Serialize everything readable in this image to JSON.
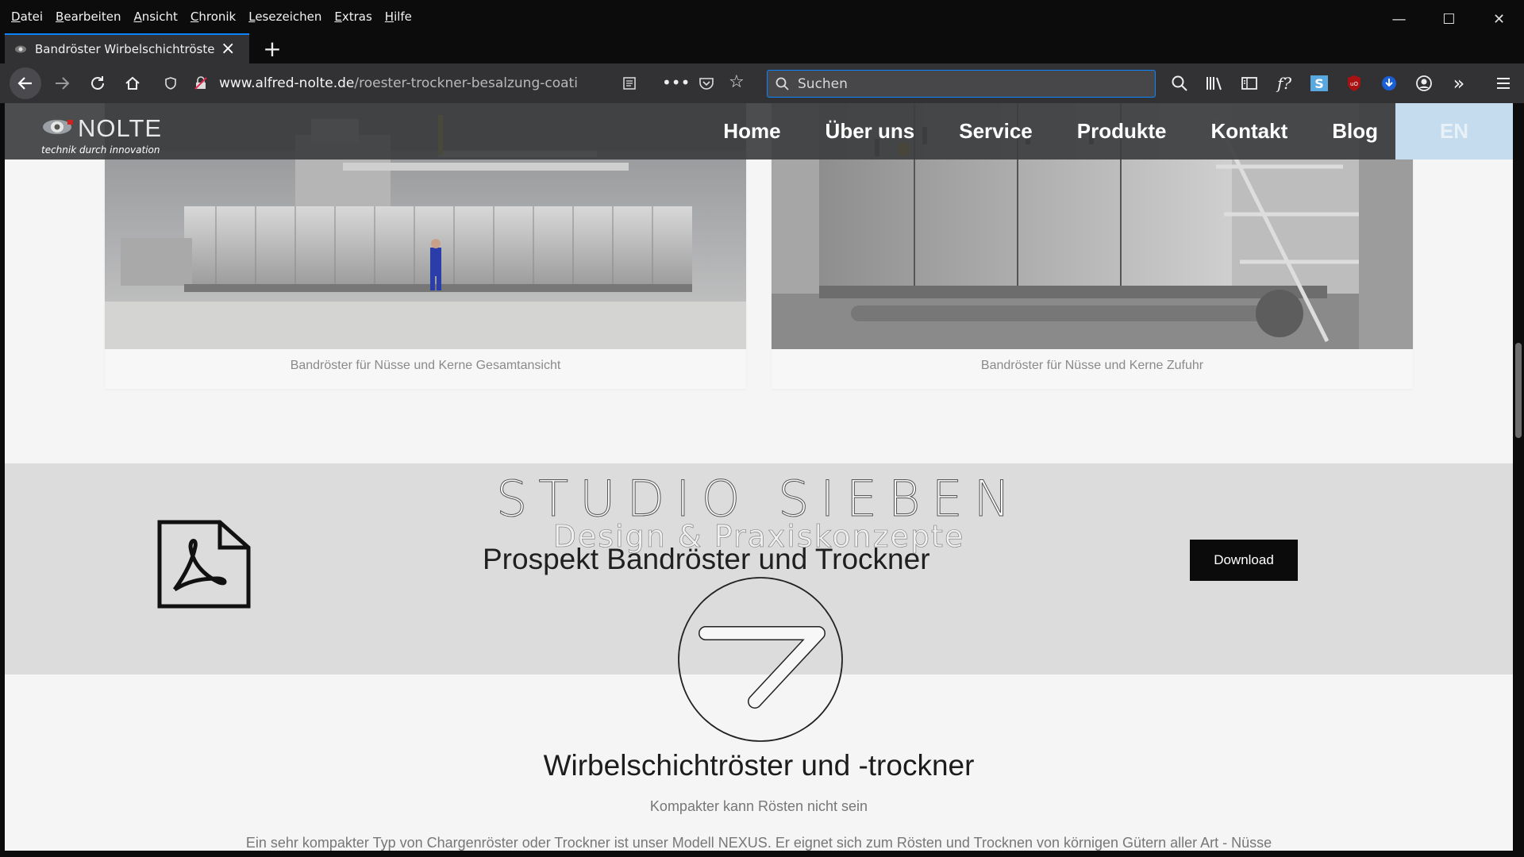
{
  "browser": {
    "menu": [
      "Datei",
      "Bearbeiten",
      "Ansicht",
      "Chronik",
      "Lesezeichen",
      "Extras",
      "Hilfe"
    ],
    "tab_title": "Bandröster Wirbelschichtröster",
    "url_domain": "www.alfred-nolte.de",
    "url_path": "/roester-trockner-besalzung-coati",
    "search_placeholder": "Suchen"
  },
  "site": {
    "logo": "NOLTE",
    "tagline": "technik durch innovation",
    "nav": [
      "Home",
      "Über uns",
      "Service",
      "Produkte",
      "Kontakt",
      "Blog"
    ],
    "lang": "EN"
  },
  "gallery": [
    {
      "caption": "Bandröster für Nüsse und Kerne Gesamtansicht"
    },
    {
      "caption": "Bandröster für Nüsse und Kerne Zufuhr"
    }
  ],
  "download": {
    "title": "Prospekt Bandröster und Trockner",
    "button": "Download"
  },
  "watermark": {
    "line1": "STUDIO SIEBEN",
    "line2": "Design & Praxiskonzepte"
  },
  "section": {
    "title": "Wirbelschichtröster und -trockner",
    "subtitle": "Kompakter kann Rösten nicht sein",
    "body": "Ein sehr kompakter Typ von Chargenröster oder Trockner ist unser Modell NEXUS. Er eignet sich zum Rösten und Trocknen von körnigen Gütern aller Art - Nüsse"
  },
  "colors": {
    "accent": "#0a84ff",
    "lang_bg": "#c5dbee",
    "band_bg": "#dcdcdc"
  }
}
